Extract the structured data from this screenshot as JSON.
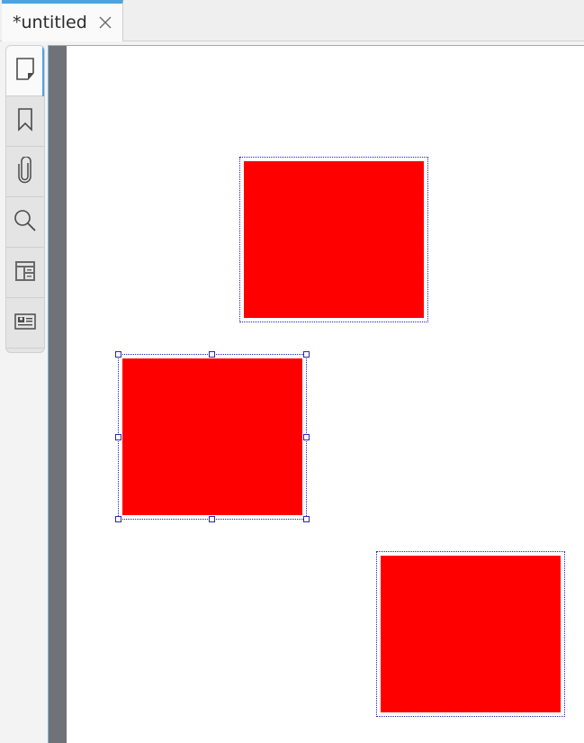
{
  "tab": {
    "title": "*untitled",
    "close_icon": "close-icon"
  },
  "sidebar": {
    "items": [
      {
        "name": "page-thumbnails",
        "icon": "page-icon",
        "active": true
      },
      {
        "name": "bookmarks",
        "icon": "bookmark-icon",
        "active": false
      },
      {
        "name": "attachments",
        "icon": "paperclip-icon",
        "active": false
      },
      {
        "name": "search",
        "icon": "search-icon",
        "active": false
      },
      {
        "name": "layers",
        "icon": "layers-icon",
        "active": false
      },
      {
        "name": "signatures",
        "icon": "signature-card-icon",
        "active": false
      }
    ]
  },
  "colors": {
    "shape_fill": "#ff0000",
    "selection_border": "#1f1fbf",
    "accent": "#4da3e0",
    "gutter": "#6f7378"
  },
  "canvas": {
    "shapes": [
      {
        "name": "red-rectangle-1",
        "selected": false
      },
      {
        "name": "red-rectangle-2",
        "selected": true
      },
      {
        "name": "red-rectangle-3",
        "selected": false
      }
    ]
  }
}
